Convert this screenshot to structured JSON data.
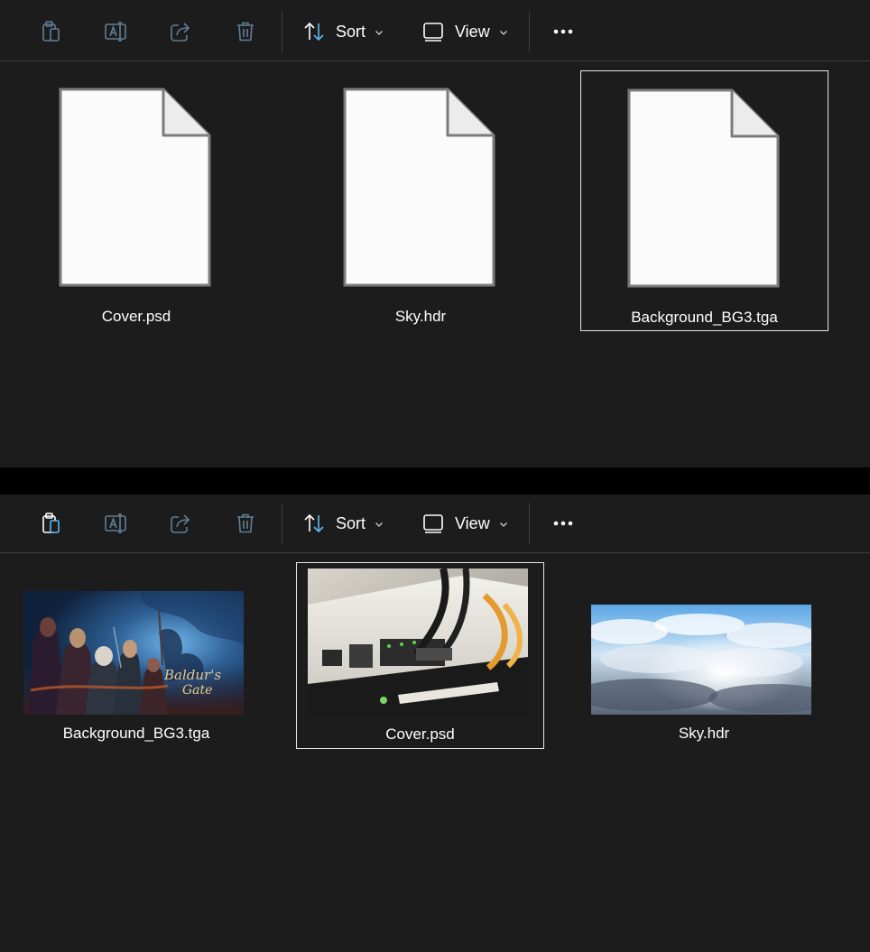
{
  "top_panel": {
    "toolbar": {
      "sort_label": "Sort",
      "view_label": "View"
    },
    "files": [
      {
        "name": "Cover.psd",
        "icon": "generic-file-icon"
      },
      {
        "name": "Sky.hdr",
        "icon": "generic-file-icon"
      },
      {
        "name": "Background_BG3.tga",
        "icon": "generic-file-icon",
        "selected": true
      }
    ]
  },
  "bottom_panel": {
    "toolbar": {
      "sort_label": "Sort",
      "view_label": "View"
    },
    "files": [
      {
        "name": "Background_BG3.tga",
        "thumbnail": "game-key-art-thumbnail",
        "thumbnail_logo": "Baldur's Gate"
      },
      {
        "name": "Cover.psd",
        "thumbnail": "network-router-cables-thumbnail",
        "selected": true
      },
      {
        "name": "Sky.hdr",
        "thumbnail": "cloudy-sky-thumbnail"
      }
    ]
  },
  "colors": {
    "background": "#1c1c1c",
    "separator": "#000000",
    "accent_blue": "#60b6f2",
    "disabled_icon": "#5f7f97",
    "text": "#ffffff",
    "selection_border": "#e6e6e6"
  }
}
